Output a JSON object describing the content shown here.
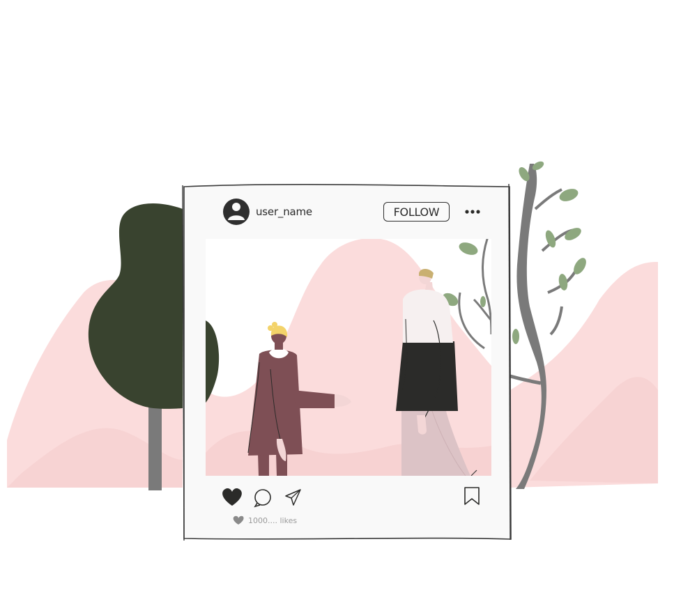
{
  "post": {
    "username": "user_name",
    "follow_label": "FOLLOW",
    "likes_text": "1000.... likes"
  },
  "icons": {
    "avatar": "avatar-icon",
    "more": "more-options-icon",
    "like": "heart-icon",
    "comment": "comment-icon",
    "share": "send-icon",
    "save": "bookmark-icon",
    "likes_small": "small-heart-icon"
  },
  "colors": {
    "hill_pink": "#fbdcdc",
    "tree_dark_green": "#39432f",
    "trunk_gray": "#7a7a7a",
    "leaf_green": "#8ea87f",
    "coat_maroon": "#7e4f55",
    "shirt_black": "#2b2b29",
    "frame_bg": "#f9f9f9"
  }
}
